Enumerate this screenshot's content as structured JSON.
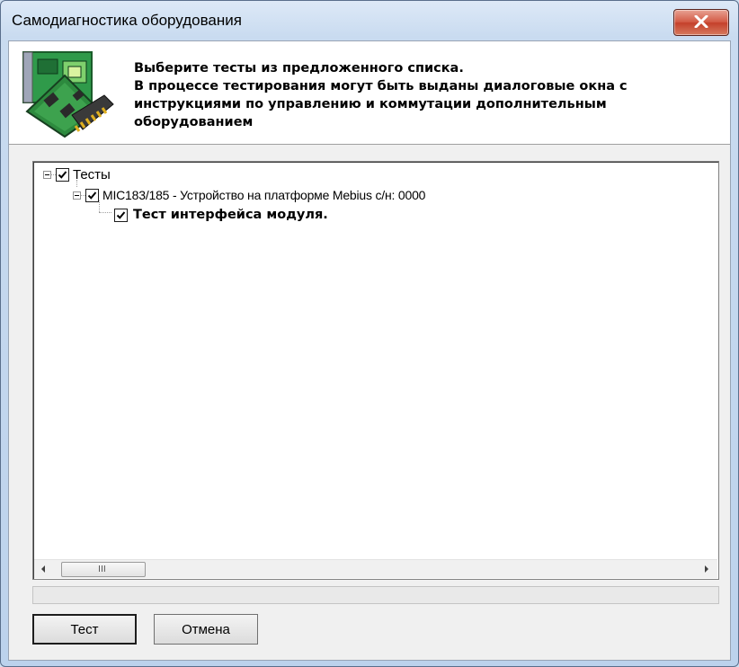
{
  "window": {
    "title": "Самодиагностика оборудования"
  },
  "header": {
    "icon": "circuit-board-icon",
    "lines": [
      "Выберите тесты из предложенного списка.",
      "В процессе тестирования могут быть выданы диалоговые окна с",
      "инструкциями по управлению и коммутации дополнительным",
      "оборудованием"
    ]
  },
  "tree": {
    "root": {
      "label": "Тесты",
      "checked": true,
      "expanded": true
    },
    "device": {
      "label": "MIC183/185 - Устройство на платформе Mebius с/н: 0000",
      "checked": true,
      "expanded": true
    },
    "test": {
      "label": "Тест интерфейса модуля.",
      "checked": true
    }
  },
  "scrollbar": {
    "thumb_label": "III"
  },
  "buttons": {
    "test_label": "Тест",
    "cancel_label": "Отмена"
  },
  "colors": {
    "close_button": "#c4402b",
    "window_frame": "#bcd2ec"
  }
}
